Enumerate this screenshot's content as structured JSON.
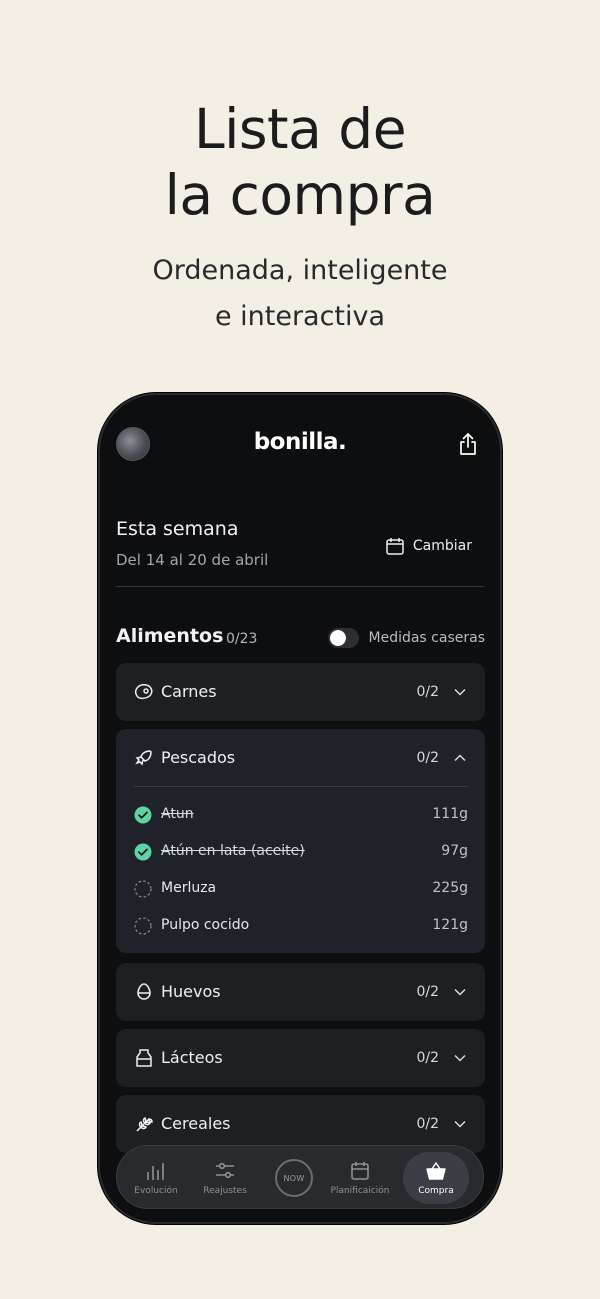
{
  "promo": {
    "title_line1": "Lista de",
    "title_line2": "la compra",
    "subtitle_line1": "Ordenada, inteligente",
    "subtitle_line2": "e interactiva"
  },
  "app": {
    "logo": "bonilla.",
    "week_title": "Esta semana",
    "week_range": "Del 14 al 20 de abril",
    "change_label": "Cambiar",
    "foods_title": "Alimentos",
    "foods_count": "0/23",
    "toggle_label": "Medidas caseras",
    "toggle_on": false
  },
  "categories": [
    {
      "label": "Carnes",
      "count": "0/2",
      "icon": "meat-icon",
      "expanded": false
    },
    {
      "label": "Pescados",
      "count": "0/2",
      "icon": "fish-icon",
      "expanded": true,
      "items": [
        {
          "label": "Atun",
          "qty": "111g",
          "checked": true
        },
        {
          "label": "Atún en lata (aceite)",
          "qty": "97g",
          "checked": true
        },
        {
          "label": "Merluza",
          "qty": "225g",
          "checked": false
        },
        {
          "label": "Pulpo cocido",
          "qty": "121g",
          "checked": false
        }
      ]
    },
    {
      "label": "Huevos",
      "count": "0/2",
      "icon": "egg-icon",
      "expanded": false
    },
    {
      "label": "Lácteos",
      "count": "0/2",
      "icon": "milk-icon",
      "expanded": false
    },
    {
      "label": "Cereales",
      "count": "0/2",
      "icon": "grain-icon",
      "expanded": false
    }
  ],
  "tabs": [
    {
      "label": "Evolución",
      "icon": "chart-bars-icon",
      "active": false
    },
    {
      "label": "Reajustes",
      "icon": "sliders-icon",
      "active": false
    },
    {
      "label": "NOW",
      "icon": "now-icon",
      "active": false
    },
    {
      "label": "Planificaición",
      "icon": "calendar-icon",
      "active": false
    },
    {
      "label": "Compra",
      "icon": "basket-icon",
      "active": true
    }
  ],
  "colors": {
    "background": "#f3efe4",
    "phone": "#0d0e10",
    "card": "#1d1f23",
    "check": "#5fd3a6"
  }
}
